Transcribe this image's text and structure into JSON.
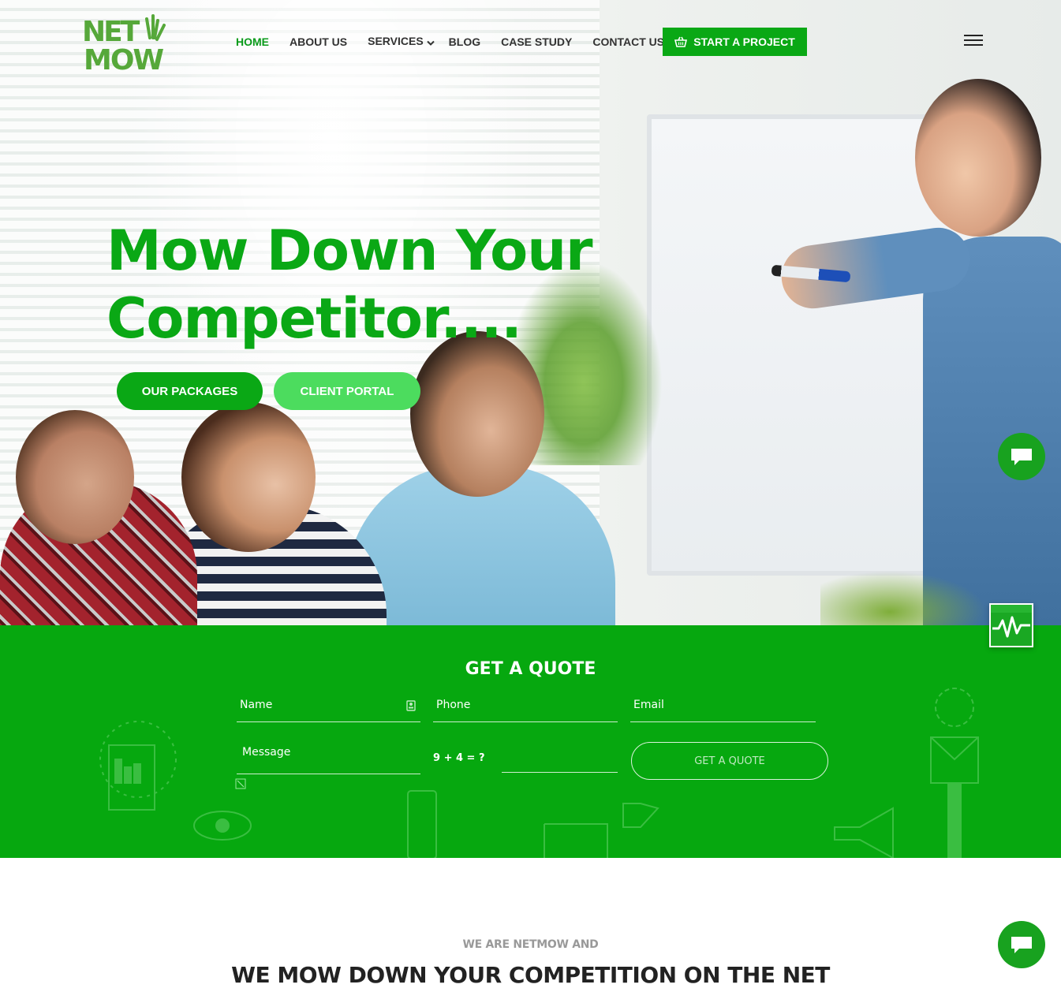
{
  "brand": {
    "logo_text_top": "NET",
    "logo_text_bottom": "MOW",
    "accent_color": "#0aa815",
    "light_accent_color": "#4cdc5e"
  },
  "nav": {
    "items": [
      {
        "label": "HOME",
        "active": true
      },
      {
        "label": "ABOUT US",
        "active": false
      },
      {
        "label": "SERVICES",
        "active": false,
        "has_dropdown": true
      },
      {
        "label": "BLOG",
        "active": false
      },
      {
        "label": "CASE STUDY",
        "active": false
      },
      {
        "label": "CONTACT US",
        "active": false
      }
    ],
    "cta_label": "START A PROJECT",
    "cta_icon": "basket-icon",
    "menu_icon": "hamburger-icon"
  },
  "hero": {
    "title_line1": "Mow Down Your",
    "title_line2": "Competitor....",
    "primary_button": "OUR PACKAGES",
    "secondary_button": "CLIENT PORTAL"
  },
  "quote": {
    "title": "GET A QUOTE",
    "name_placeholder": "Name",
    "phone_placeholder": "Phone",
    "email_placeholder": "Email",
    "message_placeholder": "Message",
    "captcha_question": "9 + 4 = ?",
    "submit_label": "GET A QUOTE"
  },
  "about": {
    "kicker": "WE ARE NETMOW AND",
    "title": "WE MOW DOWN YOUR COMPETITION ON THE NET"
  },
  "widgets": {
    "chat_icon": "chat-icon",
    "pulse_icon": "pulse-icon"
  }
}
